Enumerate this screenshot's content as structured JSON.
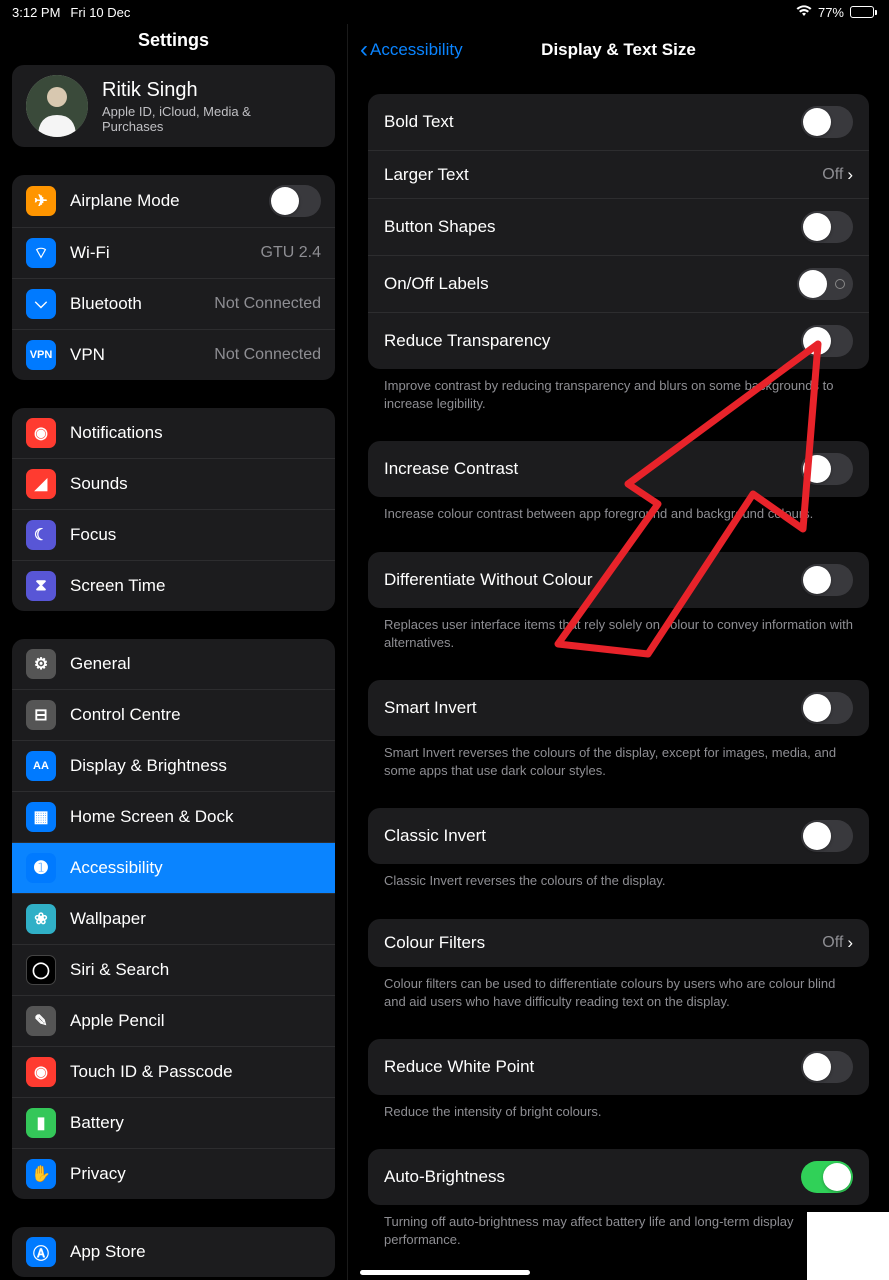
{
  "status": {
    "time": "3:12 PM",
    "date": "Fri 10 Dec",
    "wifi": true,
    "battery_pct": "77%"
  },
  "sidebar": {
    "title": "Settings",
    "profile": {
      "name": "Ritik Singh",
      "sub": "Apple ID, iCloud, Media & Purchases"
    },
    "group1": [
      {
        "icon": "airplane",
        "bg": "ic-orange",
        "label": "Airplane Mode",
        "toggle": false
      },
      {
        "icon": "wifi",
        "bg": "ic-blue",
        "label": "Wi-Fi",
        "value": "GTU 2.4"
      },
      {
        "icon": "bt",
        "bg": "ic-blue",
        "label": "Bluetooth",
        "value": "Not Connected"
      },
      {
        "icon": "vpn",
        "bg": "ic-blue",
        "label": "VPN",
        "value": "Not Connected"
      }
    ],
    "group2": [
      {
        "icon": "bell",
        "bg": "ic-red",
        "label": "Notifications"
      },
      {
        "icon": "sound",
        "bg": "ic-red",
        "label": "Sounds"
      },
      {
        "icon": "moon",
        "bg": "ic-indigo",
        "label": "Focus"
      },
      {
        "icon": "hourglass",
        "bg": "ic-indigo",
        "label": "Screen Time"
      }
    ],
    "group3": [
      {
        "icon": "gear",
        "bg": "ic-darkgray",
        "label": "General"
      },
      {
        "icon": "cc",
        "bg": "ic-darkgray",
        "label": "Control Centre"
      },
      {
        "icon": "aa",
        "bg": "ic-blue",
        "label": "Display & Brightness"
      },
      {
        "icon": "grid",
        "bg": "ic-blue",
        "label": "Home Screen & Dock"
      },
      {
        "icon": "access",
        "bg": "ic-blue",
        "label": "Accessibility",
        "selected": true
      },
      {
        "icon": "wall",
        "bg": "ic-teal",
        "label": "Wallpaper"
      },
      {
        "icon": "siri",
        "bg": "ic-black",
        "label": "Siri & Search"
      },
      {
        "icon": "pencil",
        "bg": "ic-darkgray",
        "label": "Apple Pencil"
      },
      {
        "icon": "touch",
        "bg": "ic-red",
        "label": "Touch ID & Passcode"
      },
      {
        "icon": "battery",
        "bg": "ic-green",
        "label": "Battery"
      },
      {
        "icon": "hand",
        "bg": "ic-blue",
        "label": "Privacy"
      }
    ],
    "group4": [
      {
        "icon": "appstore",
        "bg": "ic-blue",
        "label": "App Store"
      }
    ]
  },
  "detail": {
    "back": "Accessibility",
    "title": "Display & Text Size",
    "sections": [
      {
        "rows": [
          {
            "label": "Bold Text",
            "toggle": false
          },
          {
            "label": "Larger Text",
            "value": "Off",
            "chev": true
          },
          {
            "label": "Button Shapes",
            "toggle": false
          },
          {
            "label": "On/Off Labels",
            "toggle": false,
            "labels": true
          },
          {
            "label": "Reduce Transparency",
            "toggle": false
          }
        ],
        "footer": "Improve contrast by reducing transparency and blurs on some backgrounds to increase legibility."
      },
      {
        "rows": [
          {
            "label": "Increase Contrast",
            "toggle": false
          }
        ],
        "footer": "Increase colour contrast between app foreground and background colours."
      },
      {
        "rows": [
          {
            "label": "Differentiate Without Colour",
            "toggle": false
          }
        ],
        "footer": "Replaces user interface items that rely solely on colour to convey information with alternatives."
      },
      {
        "rows": [
          {
            "label": "Smart Invert",
            "toggle": false
          }
        ],
        "footer": "Smart Invert reverses the colours of the display, except for images, media, and some apps that use dark colour styles."
      },
      {
        "rows": [
          {
            "label": "Classic Invert",
            "toggle": false
          }
        ],
        "footer": "Classic Invert reverses the colours of the display."
      },
      {
        "rows": [
          {
            "label": "Colour Filters",
            "value": "Off",
            "chev": true
          }
        ],
        "footer": "Colour filters can be used to differentiate colours by users who are colour blind and aid users who have difficulty reading text on the display."
      },
      {
        "rows": [
          {
            "label": "Reduce White Point",
            "toggle": false
          }
        ],
        "footer": "Reduce the intensity of bright colours."
      },
      {
        "rows": [
          {
            "label": "Auto-Brightness",
            "toggle": true
          }
        ],
        "footer": "Turning off auto-brightness may affect battery life and long-term display performance."
      }
    ]
  }
}
